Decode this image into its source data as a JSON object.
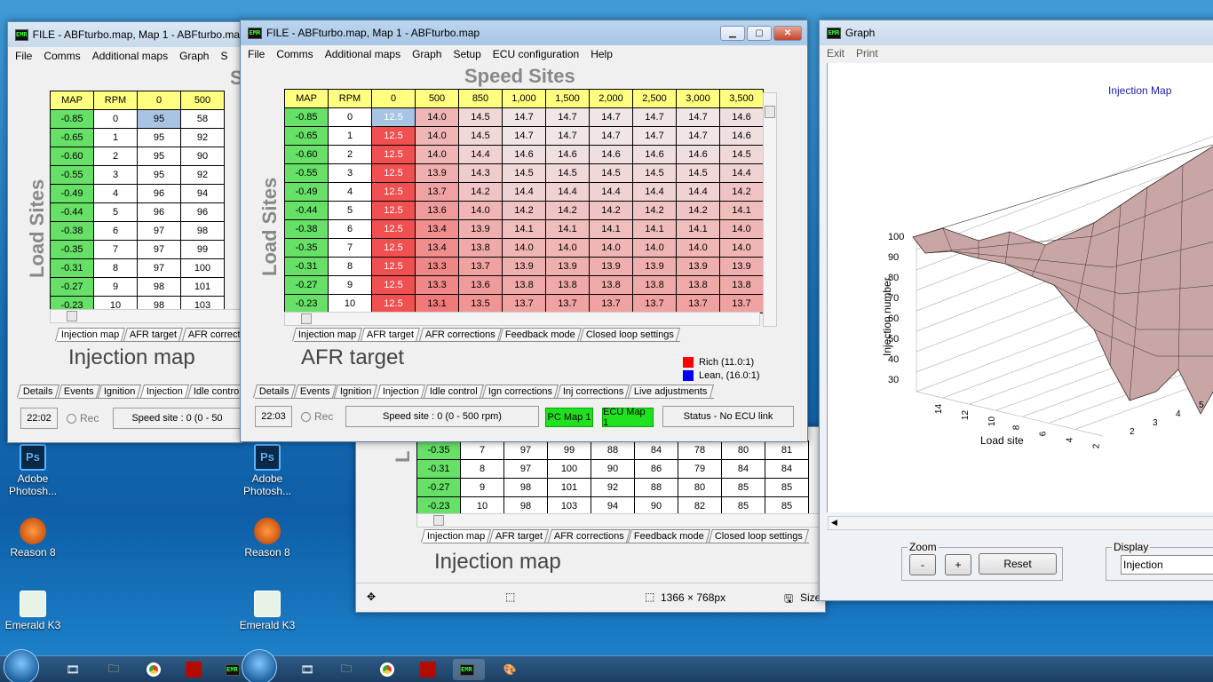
{
  "desktop": {
    "icons": [
      {
        "label": "Adobe Photosh...",
        "icon": "photoshop-icon"
      },
      {
        "label": "Reason 8",
        "icon": "reason-icon"
      },
      {
        "label": "Emerald K3",
        "icon": "emerald-icon"
      }
    ]
  },
  "back_window": {
    "title": "FILE - ABFturbo.map,  Map 1 - ABFturbo.map",
    "menu": [
      "File",
      "Comms",
      "Additional maps",
      "Graph",
      "S"
    ],
    "columns": [
      "MAP",
      "RPM",
      "0",
      "500"
    ],
    "rows": [
      [
        "-0.85",
        "0",
        "95",
        "58"
      ],
      [
        "-0.65",
        "1",
        "95",
        "92"
      ],
      [
        "-0.60",
        "2",
        "95",
        "90"
      ],
      [
        "-0.55",
        "3",
        "95",
        "92"
      ],
      [
        "-0.49",
        "4",
        "96",
        "94"
      ],
      [
        "-0.44",
        "5",
        "96",
        "96"
      ],
      [
        "-0.38",
        "6",
        "97",
        "98"
      ],
      [
        "-0.35",
        "7",
        "97",
        "99"
      ],
      [
        "-0.31",
        "8",
        "97",
        "100"
      ],
      [
        "-0.27",
        "9",
        "98",
        "101"
      ],
      [
        "-0.23",
        "10",
        "98",
        "103"
      ]
    ],
    "side_label": "Load Sites",
    "sub_tabs": [
      "Injection map",
      "AFR target",
      "AFR correctio"
    ],
    "big_title": "Injection map",
    "main_tabs": [
      "Details",
      "Events",
      "Ignition",
      "Injection",
      "Idle control"
    ],
    "time": "22:02",
    "rec": "Rec",
    "speed_site": "Speed site : 0 (0 - 50"
  },
  "middle_window": {
    "rows": [
      [
        "-0.35",
        "7",
        "97",
        "99",
        "88",
        "84",
        "78",
        "80",
        "81"
      ],
      [
        "-0.31",
        "8",
        "97",
        "100",
        "90",
        "86",
        "79",
        "84",
        "84"
      ],
      [
        "-0.27",
        "9",
        "98",
        "101",
        "92",
        "88",
        "80",
        "85",
        "85"
      ],
      [
        "-0.23",
        "10",
        "98",
        "103",
        "94",
        "90",
        "82",
        "85",
        "85"
      ]
    ],
    "side_label": "L",
    "sub_tabs": [
      "Injection map",
      "AFR target",
      "AFR corrections",
      "Feedback mode",
      "Closed loop settings"
    ],
    "big_title": "Injection map",
    "status_dims": "1366 × 768px",
    "status_size": "Size:"
  },
  "front_window": {
    "title": "FILE - ABFturbo.map,  Map 1 - ABFturbo.map",
    "menu": [
      "File",
      "Comms",
      "Additional maps",
      "Graph",
      "Setup",
      "ECU configuration",
      "Help"
    ],
    "heading": "Speed Sites",
    "side_label": "Load Sites",
    "columns": [
      "MAP",
      "RPM",
      "0",
      "500",
      "850",
      "1,000",
      "1,500",
      "2,000",
      "2,500",
      "3,000",
      "3,500"
    ],
    "rows": [
      [
        "-0.85",
        "0",
        "12.5",
        "14.0",
        "14.5",
        "14.7",
        "14.7",
        "14.7",
        "14.7",
        "14.7",
        "14.6"
      ],
      [
        "-0.65",
        "1",
        "12.5",
        "14.0",
        "14.5",
        "14.7",
        "14.7",
        "14.7",
        "14.7",
        "14.7",
        "14.6"
      ],
      [
        "-0.60",
        "2",
        "12.5",
        "14.0",
        "14.4",
        "14.6",
        "14.6",
        "14.6",
        "14.6",
        "14.6",
        "14.5"
      ],
      [
        "-0.55",
        "3",
        "12.5",
        "13.9",
        "14.3",
        "14.5",
        "14.5",
        "14.5",
        "14.5",
        "14.5",
        "14.4"
      ],
      [
        "-0.49",
        "4",
        "12.5",
        "13.7",
        "14.2",
        "14.4",
        "14.4",
        "14.4",
        "14.4",
        "14.4",
        "14.2"
      ],
      [
        "-0.44",
        "5",
        "12.5",
        "13.6",
        "14.0",
        "14.2",
        "14.2",
        "14.2",
        "14.2",
        "14.2",
        "14.1"
      ],
      [
        "-0.38",
        "6",
        "12.5",
        "13.4",
        "13.9",
        "14.1",
        "14.1",
        "14.1",
        "14.1",
        "14.1",
        "14.0"
      ],
      [
        "-0.35",
        "7",
        "12.5",
        "13.4",
        "13.8",
        "14.0",
        "14.0",
        "14.0",
        "14.0",
        "14.0",
        "14.0"
      ],
      [
        "-0.31",
        "8",
        "12.5",
        "13.3",
        "13.7",
        "13.9",
        "13.9",
        "13.9",
        "13.9",
        "13.9",
        "13.9"
      ],
      [
        "-0.27",
        "9",
        "12.5",
        "13.3",
        "13.6",
        "13.8",
        "13.8",
        "13.8",
        "13.8",
        "13.8",
        "13.8"
      ],
      [
        "-0.23",
        "10",
        "12.5",
        "13.1",
        "13.5",
        "13.7",
        "13.7",
        "13.7",
        "13.7",
        "13.7",
        "13.7"
      ]
    ],
    "sub_tabs": [
      "Injection map",
      "AFR target",
      "AFR corrections",
      "Feedback mode",
      "Closed loop settings"
    ],
    "big_title": "AFR target",
    "legend": {
      "rich": "Rich (11.0:1)",
      "lean": "Lean, (16.0:1)",
      "rich_color": "#ff0000",
      "lean_color": "#0000ff"
    },
    "main_tabs": [
      "Details",
      "Events",
      "Ignition",
      "Injection",
      "Idle control",
      "Ign corrections",
      "Inj corrections",
      "Live adjustments"
    ],
    "time": "22:03",
    "rec": "Rec",
    "speed_site": "Speed site : 0 (0 - 500 rpm)",
    "pc_map": "PC Map 1",
    "ecu_map": "ECU Map 1",
    "status": "Status - No ECU link"
  },
  "graph_window": {
    "title": "Graph",
    "menu": [
      "Exit",
      "Print"
    ],
    "plot_title": "Injection Map",
    "y_label": "Injection number",
    "x_label": "Load site",
    "y_ticks": [
      "100",
      "90",
      "80",
      "70",
      "60",
      "50",
      "40",
      "30"
    ],
    "x_ticks": [
      "14",
      "12",
      "10",
      "8",
      "6",
      "4",
      "2"
    ],
    "x2_ticks": [
      "2",
      "3",
      "4",
      "5"
    ],
    "zoom_label": "Zoom",
    "zoom_minus": "-",
    "zoom_plus": "+",
    "reset": "Reset",
    "display_label": "Display",
    "display_value": "Injection"
  }
}
